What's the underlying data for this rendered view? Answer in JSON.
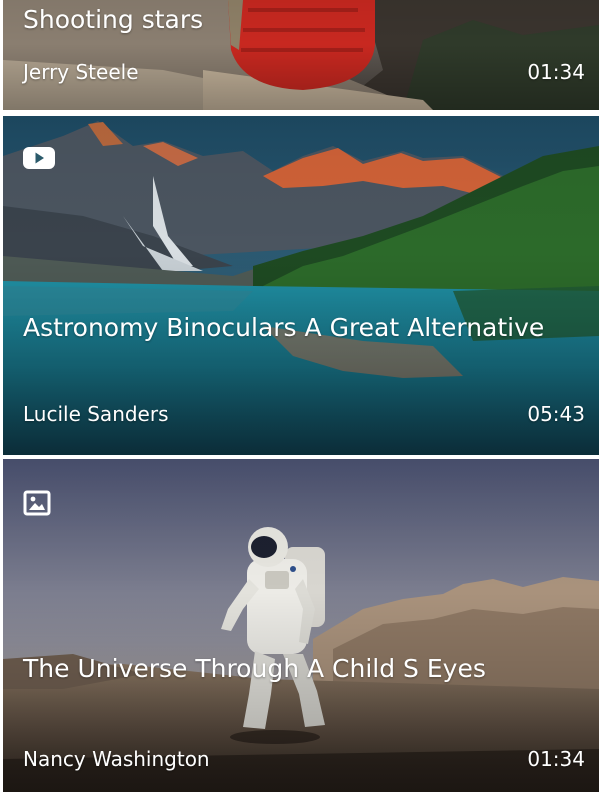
{
  "feed": {
    "items": [
      {
        "title": "Shooting stars",
        "author": "Jerry Steele",
        "duration": "01:34",
        "media_icon": "none"
      },
      {
        "title": "Astronomy Binoculars A Great Alternative",
        "author": "Lucile Sanders",
        "duration": "05:43",
        "media_icon": "video-play-icon"
      },
      {
        "title": "The Universe Through A Child S Eyes",
        "author": "Nancy Washington",
        "duration": "01:34",
        "media_icon": "image-icon"
      }
    ]
  },
  "colors": {
    "text": "#ffffff",
    "divider": "#ffffff"
  }
}
